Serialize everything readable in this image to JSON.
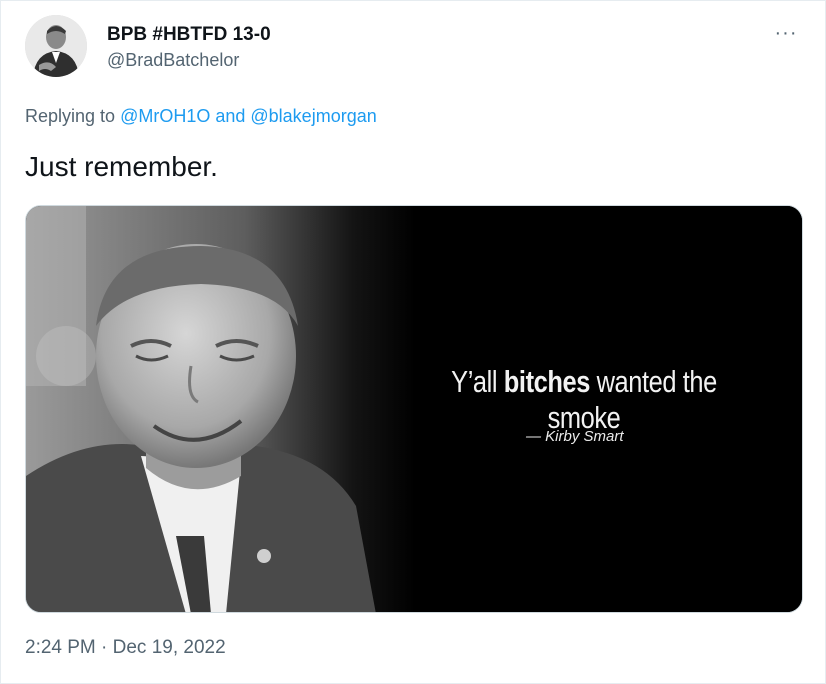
{
  "author": {
    "display_name": "BPB #HBTFD 13-0",
    "handle": "@BradBatchelor",
    "avatar_icon": "user-avatar"
  },
  "more_icon": "ellipsis-icon",
  "more_label": "···",
  "reply": {
    "prefix": "Replying to ",
    "mention_1": "@MrOH1O",
    "joiner": " and ",
    "mention_2": "@blakejmorgan"
  },
  "text": "Just remember.",
  "media": {
    "quote_prefix": "Y’all ",
    "quote_bold": "bitches",
    "quote_suffix": " wanted the smoke",
    "attribution": "— Kirby Smart"
  },
  "timestamp": "2:24 PM · Dec 19, 2022",
  "colors": {
    "link": "#1d9bf0",
    "secondary": "#536471",
    "primary_text": "#0f1419"
  }
}
